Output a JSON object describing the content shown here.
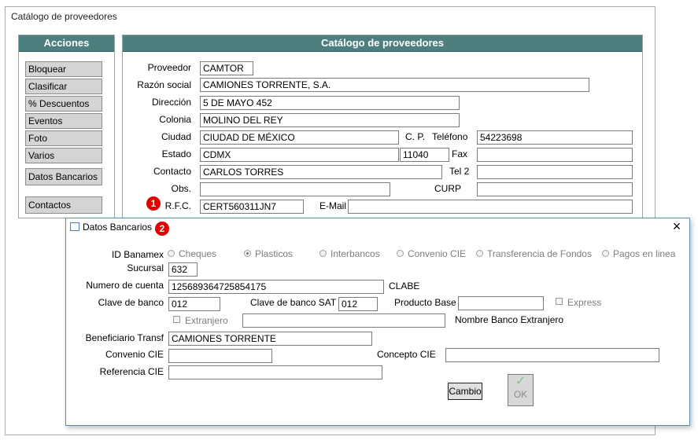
{
  "window": {
    "title": "Catálogo de proveedores"
  },
  "sidebar": {
    "header": "Acciones",
    "items": [
      {
        "label": "Bloquear"
      },
      {
        "label": "Clasificar"
      },
      {
        "label": "% Descuentos"
      },
      {
        "label": "Eventos"
      },
      {
        "label": "Foto"
      },
      {
        "label": "Varios"
      },
      {
        "label": "Datos Bancarios"
      },
      {
        "label": "Contactos"
      }
    ]
  },
  "main": {
    "header": "Catálogo de proveedores",
    "labels": {
      "proveedor": "Proveedor",
      "razon": "Razón social",
      "direccion": "Dirección",
      "colonia": "Colonia",
      "ciudad": "Ciudad",
      "cp": "C. P.",
      "telefono": "Teléfono",
      "estado": "Estado",
      "fax": "Fax",
      "contacto": "Contacto",
      "tel2": "Tel 2",
      "obs": "Obs.",
      "curp": "CURP",
      "rfc": "R.F.C.",
      "email": "E-Mail"
    },
    "values": {
      "proveedor": "CAMTOR",
      "razon": "CAMIONES TORRENTE, S.A.",
      "direccion": "5 DE MAYO 452",
      "colonia": "MOLINO DEL REY",
      "ciudad": "CIUDAD DE MÉXICO",
      "telefono": "54223698",
      "estado": "CDMX",
      "cp": "11040",
      "fax": "",
      "contacto": "CARLOS TORRES",
      "tel2": "",
      "obs": "",
      "curp": "",
      "rfc": "CERT560311JN7",
      "email": ""
    },
    "badge1": "1"
  },
  "dialog": {
    "title": "Datos Bancarios",
    "badge2": "2",
    "close": "×",
    "labels": {
      "id_banamex": "ID Banamex",
      "sucursal": "Sucursal",
      "numero_cuenta": "Numero de cuenta",
      "clabe": "CLABE",
      "clave_banco": "Clave de banco",
      "clave_banco_sat": "Clave de banco SAT",
      "producto_base": "Producto Base",
      "express": "Express",
      "extranjero": "Extranjero",
      "nombre_banco_ext": "Nombre Banco Extranjero",
      "beneficiario": "Beneficiario Transf",
      "convenio": "Convenio CIE",
      "concepto": "Concepto CIE",
      "referencia": "Referencia CIE"
    },
    "radios": [
      {
        "label": "Cheques",
        "selected": false
      },
      {
        "label": "Plasticos",
        "selected": true
      },
      {
        "label": "Interbancos",
        "selected": false
      },
      {
        "label": "Convenio CIE",
        "selected": false
      },
      {
        "label": "Transferencia de Fondos",
        "selected": false
      },
      {
        "label": "Pagos en linea",
        "selected": false
      }
    ],
    "values": {
      "sucursal": "632",
      "numero_cuenta": "125689364725854175",
      "clave_banco": "012",
      "clave_banco_sat": "012",
      "producto_base": "",
      "nombre_banco_ext": "",
      "beneficiario": "CAMIONES TORRENTE",
      "convenio": "",
      "concepto": "",
      "referencia": ""
    },
    "buttons": {
      "cambio": "Cambio",
      "ok": "OK",
      "ok_icon": "✓"
    }
  }
}
